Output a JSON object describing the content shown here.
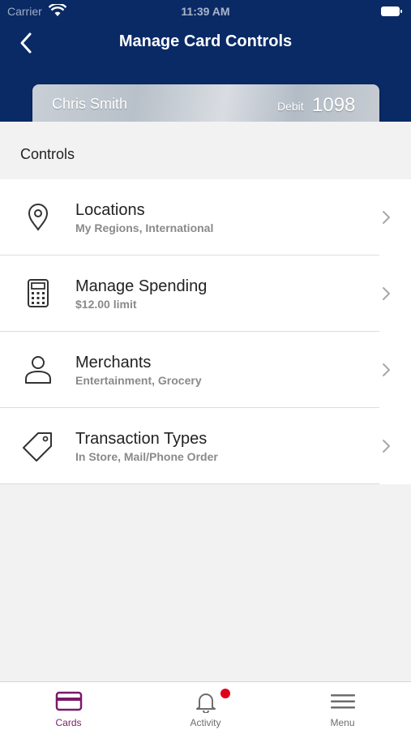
{
  "status_bar": {
    "carrier": "Carrier",
    "time": "11:39 AM"
  },
  "header": {
    "title": "Manage Card Controls"
  },
  "card": {
    "name": "Chris Smith",
    "type": "Debit",
    "last_digits": "1098"
  },
  "section": {
    "label": "Controls"
  },
  "controls": [
    {
      "title": "Locations",
      "subtitle": "My Regions, International",
      "icon": "location-pin-icon"
    },
    {
      "title": "Manage Spending",
      "subtitle": "$12.00 limit",
      "icon": "calculator-icon"
    },
    {
      "title": "Merchants",
      "subtitle": "Entertainment, Grocery",
      "icon": "person-icon"
    },
    {
      "title": "Transaction Types",
      "subtitle": "In Store, Mail/Phone Order",
      "icon": "tag-icon"
    }
  ],
  "tabs": [
    {
      "label": "Cards",
      "icon": "card-icon",
      "active": true
    },
    {
      "label": "Activity",
      "icon": "bell-icon",
      "active": false,
      "has_notification": true
    },
    {
      "label": "Menu",
      "icon": "hamburger-menu-icon",
      "active": false
    }
  ],
  "colors": {
    "header_bg": "#0a2a66",
    "accent": "#7a1a6b",
    "notification": "#e0001b",
    "background": "#f2f2f2"
  }
}
